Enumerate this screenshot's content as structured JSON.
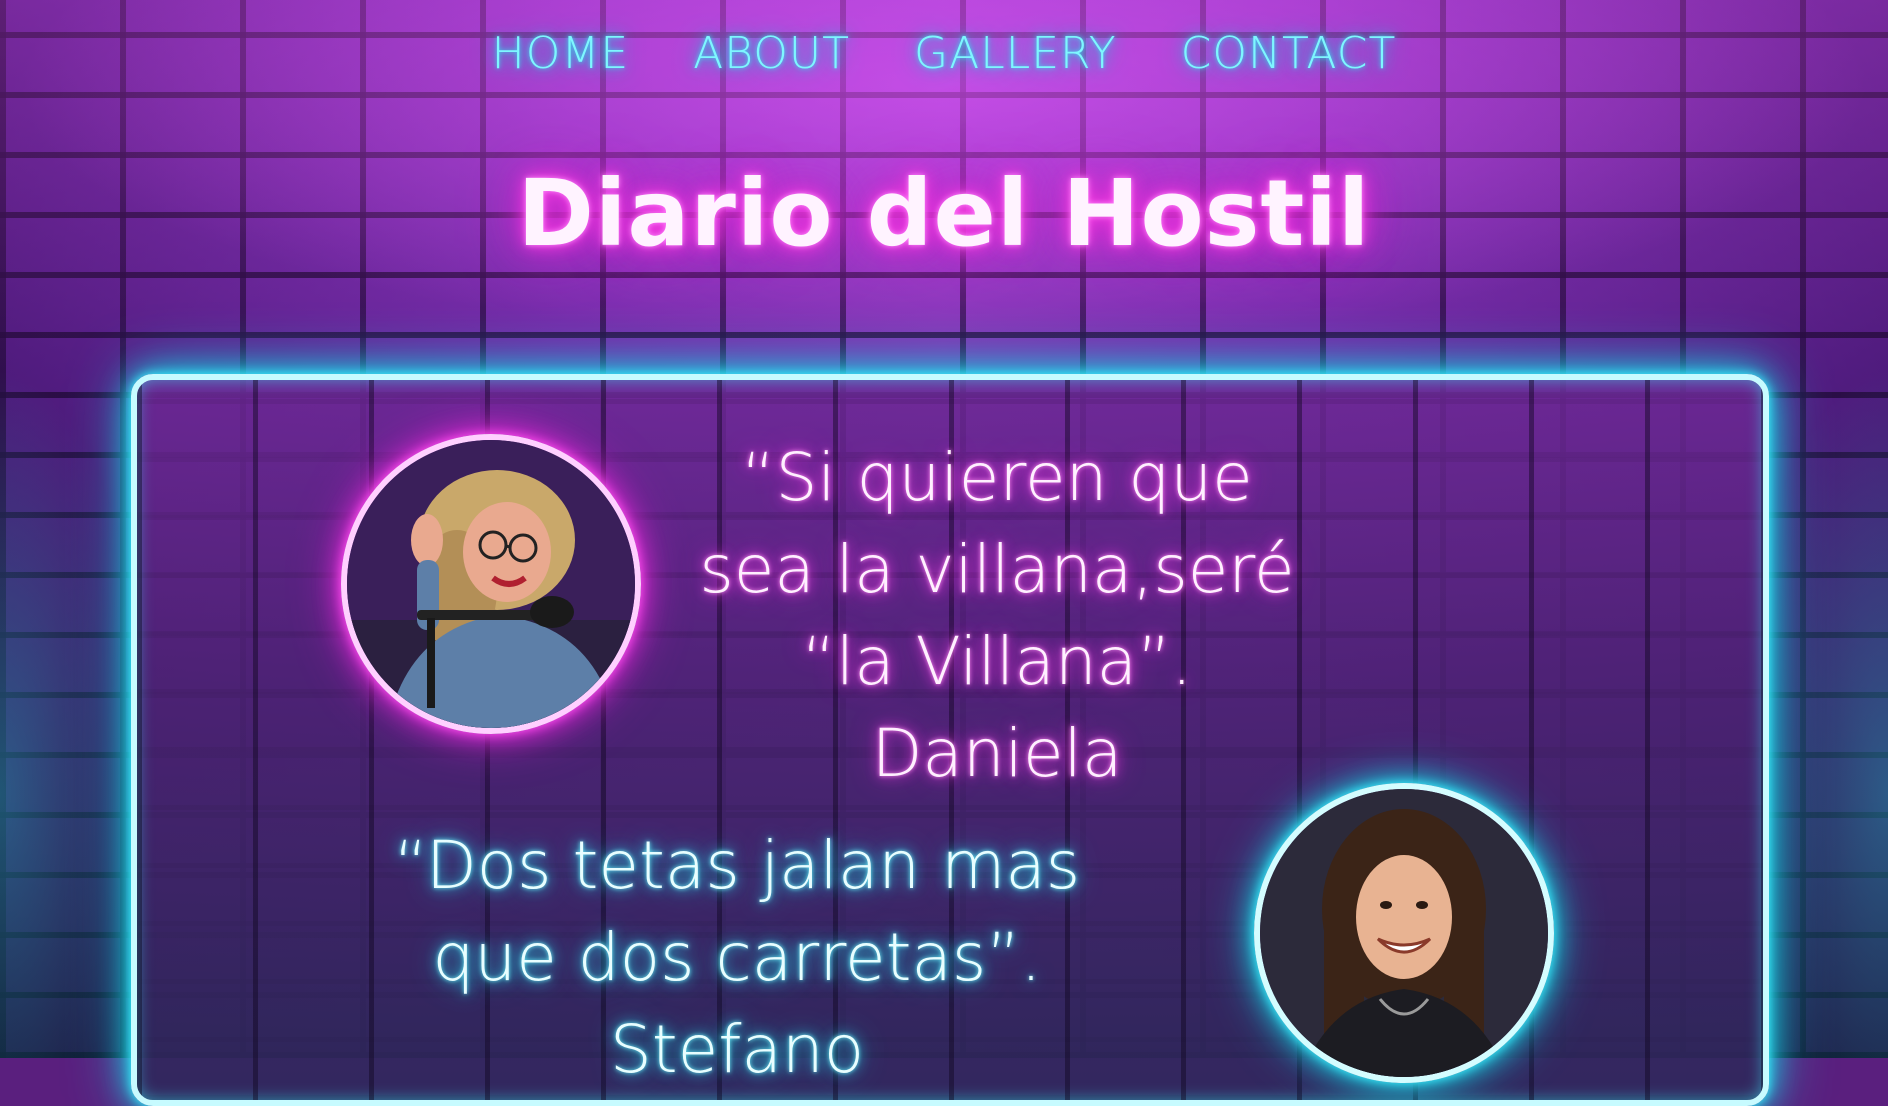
{
  "nav": {
    "items": [
      {
        "label": "HOME"
      },
      {
        "label": "ABOUT"
      },
      {
        "label": "GALLERY"
      },
      {
        "label": "CONTACT"
      }
    ]
  },
  "header": {
    "title": "Diario del Hostil"
  },
  "quotes": [
    {
      "text": "“Si quieren que sea la villana,seré “la Villana”. Daniela",
      "color": "#ff4fe8"
    },
    {
      "text": "“Dos tetas jalan mas que dos carretas”. Stefano",
      "color": "#2fe3f2"
    }
  ],
  "colors": {
    "neon_pink": "#ff3fe6",
    "neon_cyan": "#1ed9ea",
    "wall_purple": "#7a2fb0"
  },
  "icons": {
    "avatar_1": "person-photo-woman-with-microphone",
    "avatar_2": "person-photo-man-long-hair"
  }
}
